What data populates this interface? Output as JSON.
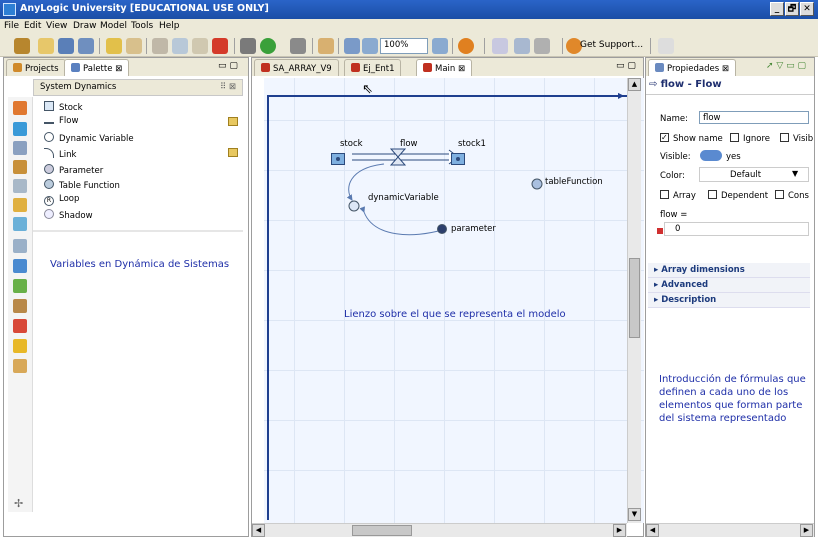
{
  "window": {
    "title": "AnyLogic University [EDUCATIONAL USE ONLY]",
    "controls": [
      "_",
      "🗗",
      "✕"
    ]
  },
  "menu": [
    "File",
    "Edit",
    "View",
    "Draw",
    "Model",
    "Tools",
    "Help"
  ],
  "toolbar": {
    "zoom": "100%",
    "get_support": "Get Support..."
  },
  "left_panel": {
    "tabs": [
      {
        "label": "Projects"
      },
      {
        "label": "Palette ⊠"
      }
    ],
    "section_title": "System Dynamics",
    "items": [
      {
        "label": "Stock",
        "icon": "stock-icon"
      },
      {
        "label": "Flow",
        "icon": "flow-icon"
      },
      {
        "label": "Dynamic Variable",
        "icon": "dynamic-variable-icon"
      },
      {
        "label": "Link",
        "icon": "link-icon"
      },
      {
        "label": "Parameter",
        "icon": "parameter-icon"
      },
      {
        "label": "Table Function",
        "icon": "table-function-icon"
      },
      {
        "label": "Loop",
        "icon": "loop-icon"
      },
      {
        "label": "Shadow",
        "icon": "shadow-icon"
      }
    ],
    "annotation": "Variables en Dynámica de Sistemas"
  },
  "editor": {
    "tabs": [
      {
        "label": "SA_ARRAY_V9"
      },
      {
        "label": "Ej_Ent1"
      },
      {
        "label": "Main ⊠"
      }
    ],
    "elements": {
      "stock": "stock",
      "flow": "flow",
      "stock1": "stock1",
      "dynamicVariable": "dynamicVariable",
      "parameter": "parameter",
      "tableFunction": "tableFunction"
    },
    "annotation": "Lienzo sobre el que se representa el modelo"
  },
  "properties": {
    "tab": "Propiedades ⊠",
    "header": "flow - Flow",
    "name_label": "Name:",
    "name_value": "flow",
    "show_name": "Show name",
    "ignore": "Ignore",
    "visible_cut": "Visib",
    "visible_label": "Visible:",
    "visible_value": "yes",
    "color_label": "Color:",
    "color_value": "Default",
    "array": "Array",
    "dependent": "Dependent",
    "constant_cut": "Cons",
    "formula_label": "flow =",
    "formula_value": "0",
    "sections": [
      "Array dimensions",
      "Advanced",
      "Description"
    ],
    "annotation": "Introducción de fórmulas que definen a cada uno de los elementos que forman parte del sistema representado"
  },
  "colors": {
    "annotation_blue": "#1f2fa8",
    "title_blue": "#1b4ea6",
    "chrome": "#ece9d8"
  }
}
